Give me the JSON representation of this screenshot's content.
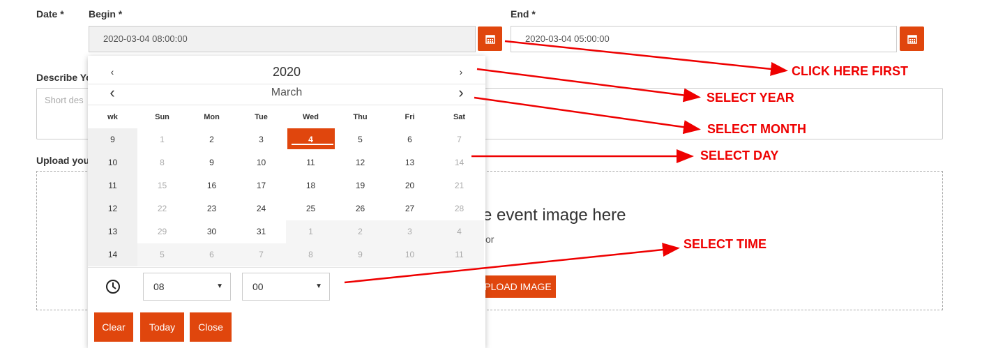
{
  "form": {
    "date_label": "Date *",
    "begin_label": "Begin *",
    "end_label": "End *",
    "begin_value": "2020-03-04 08:00:00",
    "end_value": "2020-03-04 05:00:00",
    "describe_label": "Describe Yo",
    "describe_placeholder": "Short des",
    "upload_label": "Upload you",
    "drop_text": "e event image here",
    "drop_or": "or",
    "upload_button": "PLOAD IMAGE"
  },
  "calendar": {
    "year": "2020",
    "month": "March",
    "prev_glyph": "‹",
    "next_glyph": "›",
    "headers": [
      "wk",
      "Sun",
      "Mon",
      "Tue",
      "Wed",
      "Thu",
      "Fri",
      "Sat"
    ],
    "weeks": [
      [
        "9",
        "1",
        "2",
        "3",
        "4",
        "5",
        "6",
        "7"
      ],
      [
        "10",
        "8",
        "9",
        "10",
        "11",
        "12",
        "13",
        "14"
      ],
      [
        "11",
        "15",
        "16",
        "17",
        "18",
        "19",
        "20",
        "21"
      ],
      [
        "12",
        "22",
        "23",
        "24",
        "25",
        "26",
        "27",
        "28"
      ],
      [
        "13",
        "29",
        "30",
        "31",
        "1",
        "2",
        "3",
        "4"
      ],
      [
        "14",
        "5",
        "6",
        "7",
        "8",
        "9",
        "10",
        "11"
      ]
    ],
    "selected_day": "4",
    "hour": "08",
    "minute": "00",
    "clear_label": "Clear",
    "today_label": "Today",
    "close_label": "Close"
  },
  "annotations": {
    "click_here_first": "CLICK HERE FIRST",
    "select_year": "SELECT YEAR",
    "select_month": "SELECT MONTH",
    "select_day": "SELECT DAY",
    "select_time": "SELECT TIME"
  },
  "colors": {
    "accent": "#e0460d",
    "annotation": "#ee0000"
  }
}
